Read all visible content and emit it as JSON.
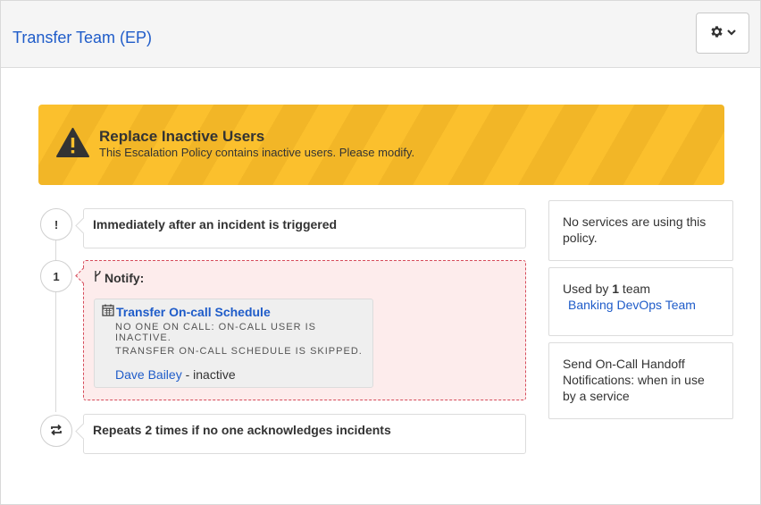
{
  "header": {
    "title": "Transfer Team (EP)",
    "settings_icon": "gear-icon",
    "dropdown_icon": "chevron-down-icon"
  },
  "banner": {
    "icon": "warning-icon",
    "title": "Replace Inactive Users",
    "message": "This Escalation Policy contains inactive users. Please modify.",
    "color": "#fbc02d"
  },
  "timeline": {
    "trigger": {
      "icon_text": "!",
      "text": "Immediately after an incident is triggered"
    },
    "rule": {
      "number": "1",
      "notify_label": "Notify:",
      "notify_icon": "branch-icon",
      "schedule": {
        "icon": "calendar-icon",
        "name": "Transfer On-call Schedule",
        "note1": "NO ONE ON CALL: ON-CALL USER IS INACTIVE.",
        "note2": "TRANSFER ON-CALL SCHEDULE IS SKIPPED.",
        "user_name": "Dave Bailey",
        "user_status": " - inactive"
      }
    },
    "repeat": {
      "icon": "repeat-icon",
      "text": "Repeats 2 times if no one acknowledges incidents"
    }
  },
  "sidebar": {
    "services": "No services are using this policy.",
    "used_by_prefix": "Used by ",
    "used_by_count": "1",
    "used_by_suffix": " team",
    "team_name": "Banking DevOps Team",
    "handoff": "Send On-Call Handoff Notifications: when in use by a service"
  },
  "colors": {
    "link": "#1f5cc9",
    "danger_border": "#d64c5b",
    "danger_bg": "#fdecec"
  }
}
